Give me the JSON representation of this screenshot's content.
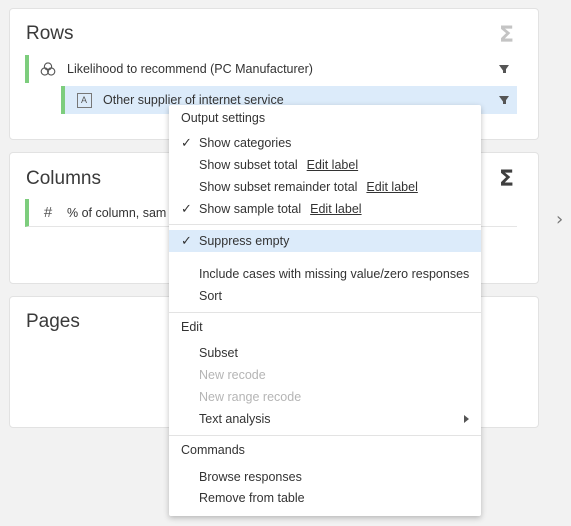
{
  "rows": {
    "title": "Rows",
    "items": [
      {
        "label": "Likelihood to recommend (PC Manufacturer)",
        "icon": "three-circles-icon"
      },
      {
        "label": "Other supplier of internet service",
        "icon": "text-a-icon"
      }
    ]
  },
  "columns": {
    "title": "Columns",
    "items": [
      {
        "label": "% of column, sam",
        "icon": "hash-icon"
      }
    ]
  },
  "pages": {
    "title": "Pages"
  },
  "menu": {
    "output_settings": {
      "heading": "Output settings",
      "show_categories": "Show categories",
      "show_subset_total": "Show subset total",
      "show_subset_total_link": "Edit label",
      "show_subset_remainder_total": "Show subset remainder total",
      "show_subset_remainder_total_link": "Edit label",
      "show_sample_total": "Show sample total",
      "show_sample_total_link": "Edit label",
      "suppress_empty": "Suppress empty",
      "include_missing": "Include cases with missing value/zero responses",
      "sort": "Sort"
    },
    "edit": {
      "heading": "Edit",
      "subset": "Subset",
      "new_recode": "New recode",
      "new_range_recode": "New range recode",
      "text_analysis": "Text analysis"
    },
    "commands": {
      "heading": "Commands",
      "browse_responses": "Browse responses",
      "remove_from_table": "Remove from table"
    },
    "check_glyph": "✓"
  },
  "colors": {
    "accent_bar": "#7dcd7d",
    "highlight": "#dcebfa"
  }
}
